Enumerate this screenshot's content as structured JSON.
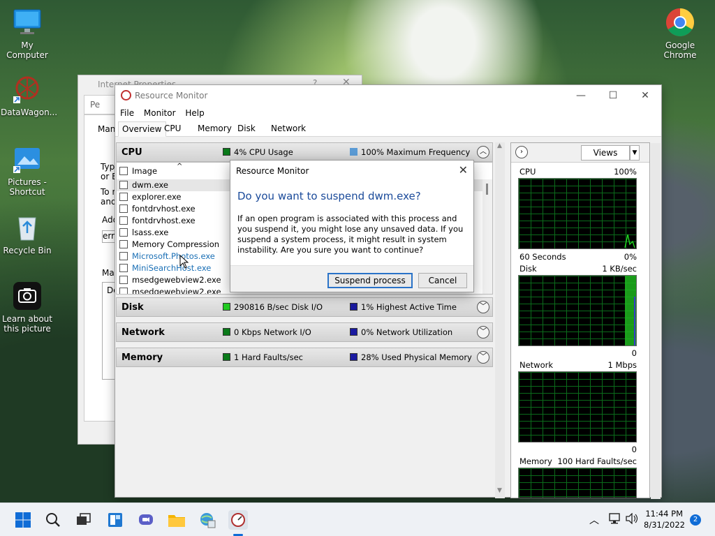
{
  "desktop": {
    "icons": [
      {
        "label": "My Computer"
      },
      {
        "label": "DataWagon..."
      },
      {
        "label": "Pictures - Shortcut"
      },
      {
        "label": "Recycle Bin"
      },
      {
        "label": "Learn about this picture"
      },
      {
        "label": "Google Chrome"
      }
    ]
  },
  "internet_properties": {
    "title": "Internet Properties",
    "tab_partial": "Pe",
    "frag1": "Mana",
    "frag2": "Type",
    "frag3": "or Bl",
    "frag4": "To n",
    "frag5": "and",
    "frag6": "Add",
    "frag7": "erro",
    "frag8": "Mar",
    "frag9": "Do"
  },
  "resource_monitor": {
    "title": "Resource Monitor",
    "menu": [
      "File",
      "Monitor",
      "Help"
    ],
    "tabs": [
      "Overview",
      "CPU",
      "Memory",
      "Disk",
      "Network"
    ],
    "active_tab": "Overview",
    "sections": {
      "cpu": {
        "name": "CPU",
        "metric1": "4% CPU Usage",
        "metric2": "100% Maximum Frequency",
        "color1": "#0a7a1a",
        "color2": "#5b9bd5"
      },
      "disk": {
        "name": "Disk",
        "metric1": "290816 B/sec Disk I/O",
        "metric2": "1% Highest Active Time",
        "color1": "#22cc22",
        "color2": "#1a1aa0"
      },
      "network": {
        "name": "Network",
        "metric1": "0 Kbps Network I/O",
        "metric2": "0% Network Utilization",
        "color1": "#0a7a1a",
        "color2": "#1a1aa0"
      },
      "memory": {
        "name": "Memory",
        "metric1": "1 Hard Faults/sec",
        "metric2": "28% Used Physical Memory",
        "color1": "#0a7a1a",
        "color2": "#1a1aa0"
      }
    },
    "process_header": "Image",
    "processes": [
      {
        "name": "dwm.exe",
        "blue": false
      },
      {
        "name": "explorer.exe",
        "blue": false
      },
      {
        "name": "fontdrvhost.exe",
        "blue": false
      },
      {
        "name": "fontdrvhost.exe",
        "blue": false
      },
      {
        "name": "lsass.exe",
        "blue": false
      },
      {
        "name": "Memory Compression",
        "blue": false
      },
      {
        "name": "Microsoft.Photos.exe",
        "blue": true
      },
      {
        "name": "MiniSearchHost.exe",
        "blue": true
      },
      {
        "name": "msedgewebview2.exe",
        "blue": false
      },
      {
        "name": "msedgewebview2.exe",
        "blue": false
      }
    ],
    "graphs": {
      "views_label": "Views",
      "cpu": {
        "label": "CPU",
        "max": "100%",
        "footer_left": "60 Seconds",
        "footer_right": "0%"
      },
      "disk": {
        "label": "Disk",
        "max": "1 KB/sec",
        "footer_right": "0"
      },
      "network": {
        "label": "Network",
        "max": "1 Mbps",
        "footer_right": "0"
      },
      "memory": {
        "label": "Memory",
        "max": "100 Hard Faults/sec"
      }
    }
  },
  "dialog": {
    "title": "Resource Monitor",
    "heading": "Do you want to suspend dwm.exe?",
    "body": "If an open program is associated with this process and you suspend it, you might lose any unsaved data. If you suspend a system process, it might result in system instability. Are you sure you want to continue?",
    "primary": "Suspend process",
    "cancel": "Cancel"
  },
  "taskbar": {
    "time": "11:44 PM",
    "date": "8/31/2022",
    "notification_count": "2"
  }
}
